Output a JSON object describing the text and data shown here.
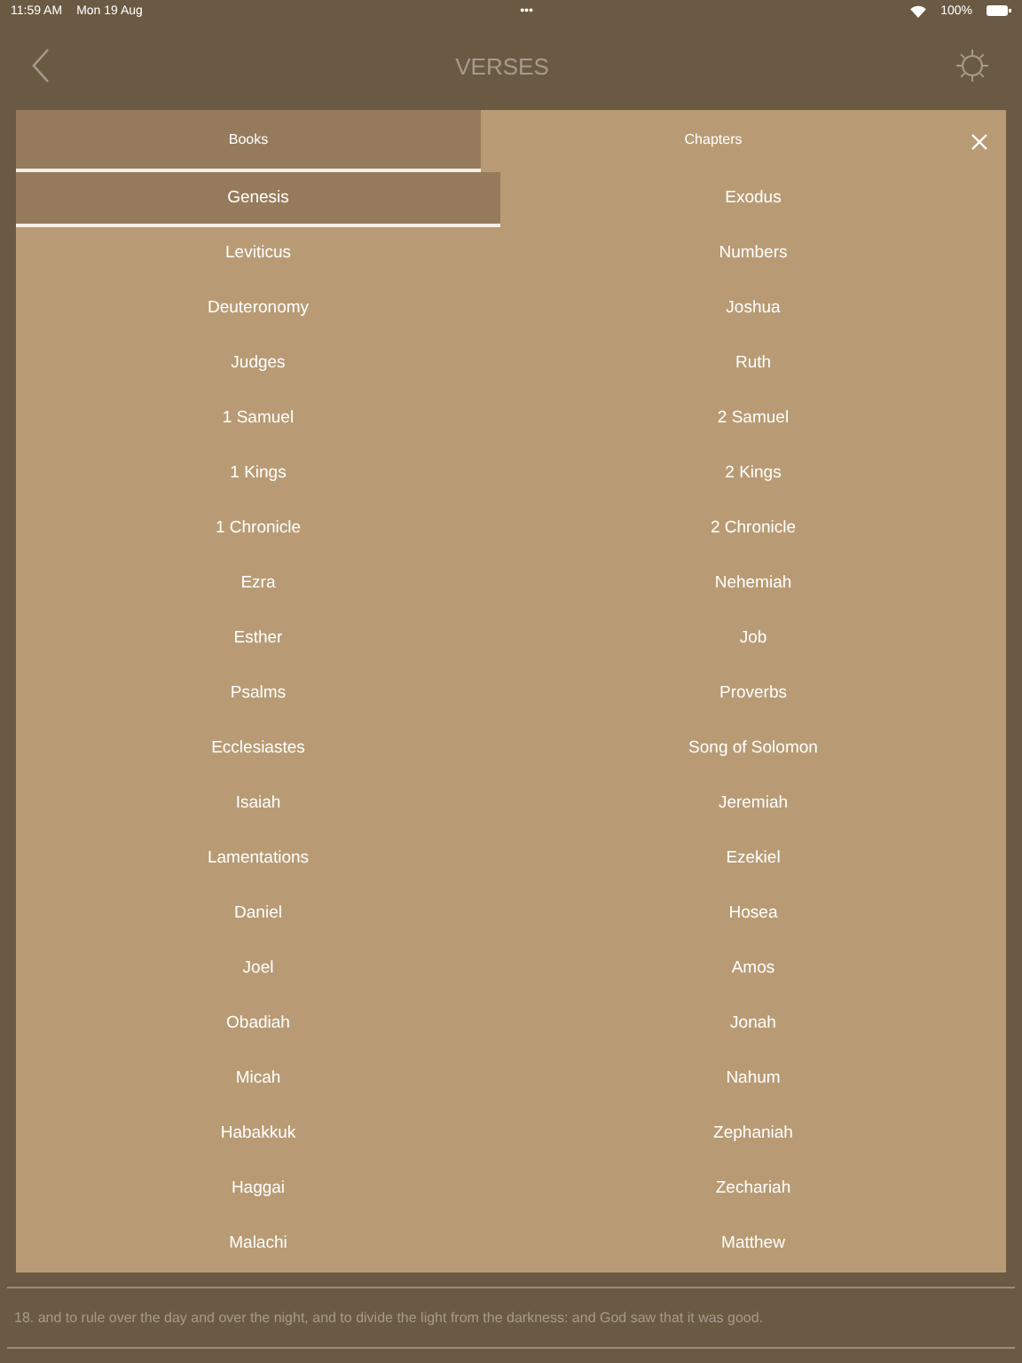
{
  "status_bar": {
    "time": "11:59 AM",
    "date": "Mon 19 Aug",
    "dots": "•••",
    "battery": "100%"
  },
  "header": {
    "title": "VERSES"
  },
  "tabs": [
    {
      "label": "Books",
      "selected": true
    },
    {
      "label": "Chapters",
      "selected": false
    }
  ],
  "books": [
    {
      "label": "Genesis",
      "selected": true
    },
    {
      "label": "Exodus",
      "selected": false
    },
    {
      "label": "Leviticus",
      "selected": false
    },
    {
      "label": "Numbers",
      "selected": false
    },
    {
      "label": "Deuteronomy",
      "selected": false
    },
    {
      "label": "Joshua",
      "selected": false
    },
    {
      "label": "Judges",
      "selected": false
    },
    {
      "label": "Ruth",
      "selected": false
    },
    {
      "label": "1 Samuel",
      "selected": false
    },
    {
      "label": "2 Samuel",
      "selected": false
    },
    {
      "label": "1 Kings",
      "selected": false
    },
    {
      "label": "2 Kings",
      "selected": false
    },
    {
      "label": "1 Chronicle",
      "selected": false
    },
    {
      "label": "2 Chronicle",
      "selected": false
    },
    {
      "label": "Ezra",
      "selected": false
    },
    {
      "label": "Nehemiah",
      "selected": false
    },
    {
      "label": "Esther",
      "selected": false
    },
    {
      "label": "Job",
      "selected": false
    },
    {
      "label": "Psalms",
      "selected": false
    },
    {
      "label": "Proverbs",
      "selected": false
    },
    {
      "label": "Ecclesiastes",
      "selected": false
    },
    {
      "label": "Song of Solomon",
      "selected": false
    },
    {
      "label": "Isaiah",
      "selected": false
    },
    {
      "label": "Jeremiah",
      "selected": false
    },
    {
      "label": "Lamentations",
      "selected": false
    },
    {
      "label": "Ezekiel",
      "selected": false
    },
    {
      "label": "Daniel",
      "selected": false
    },
    {
      "label": "Hosea",
      "selected": false
    },
    {
      "label": "Joel",
      "selected": false
    },
    {
      "label": "Amos",
      "selected": false
    },
    {
      "label": "Obadiah",
      "selected": false
    },
    {
      "label": "Jonah",
      "selected": false
    },
    {
      "label": "Micah",
      "selected": false
    },
    {
      "label": "Nahum",
      "selected": false
    },
    {
      "label": "Habakkuk",
      "selected": false
    },
    {
      "label": "Zephaniah",
      "selected": false
    },
    {
      "label": "Haggai",
      "selected": false
    },
    {
      "label": "Zechariah",
      "selected": false
    },
    {
      "label": "Malachi",
      "selected": false
    },
    {
      "label": "Matthew",
      "selected": false
    }
  ],
  "verse": "18. and to rule over the day and over the night, and to divide the light from the darkness: and God saw that it was good."
}
